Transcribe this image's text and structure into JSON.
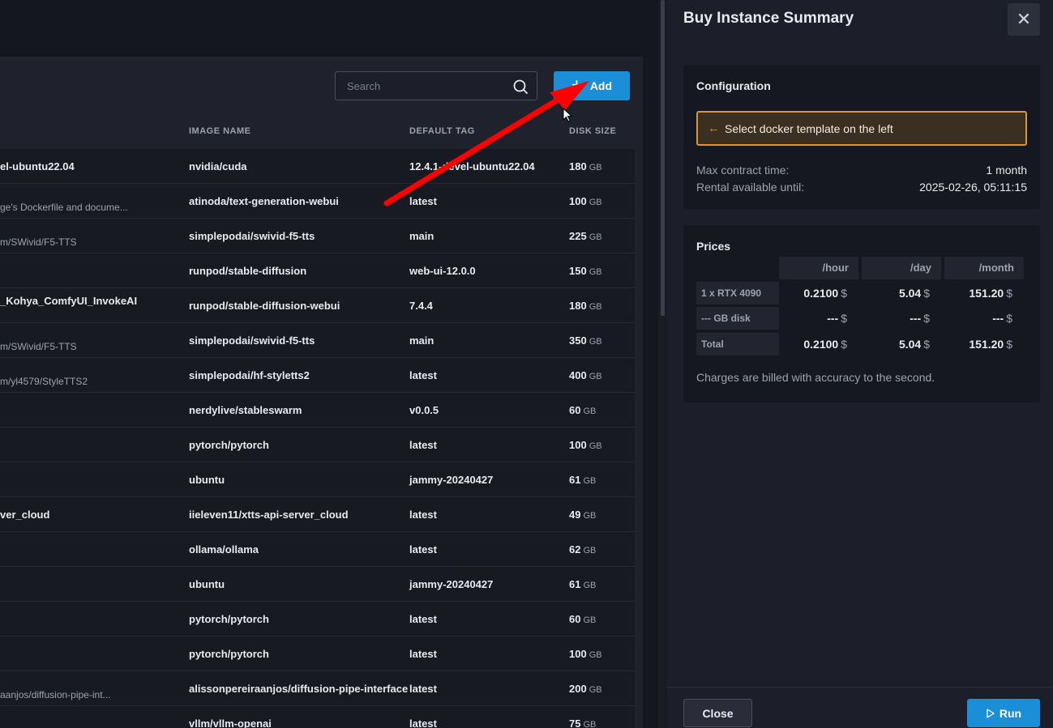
{
  "toolbar": {
    "search_placeholder": "Search",
    "add_label": "Add"
  },
  "table": {
    "headers": [
      "IMAGE NAME",
      "DEFAULT TAG",
      "DISK SIZE"
    ],
    "unit": "GB",
    "rows": [
      {
        "name": "el-ubuntu22.04",
        "image": "nvidia/cuda",
        "tag": "12.4.1-devel-ubuntu22.04",
        "size": "180"
      },
      {
        "name": "ge's Dockerfile and docume...",
        "image": "atinoda/text-generation-webui",
        "tag": "latest",
        "size": "100"
      },
      {
        "name": "m/SWivid/F5-TTS",
        "image": "simplepodai/swivid-f5-tts",
        "tag": "main",
        "size": "225"
      },
      {
        "name": "",
        "image": "runpod/stable-diffusion",
        "tag": "web-ui-12.0.0",
        "size": "150"
      },
      {
        "name": "_Kohya_ComfyUI_InvokeAI",
        "image": "runpod/stable-diffusion-webui",
        "tag": "7.4.4",
        "size": "180"
      },
      {
        "name": "m/SWivid/F5-TTS",
        "image": "simplepodai/swivid-f5-tts",
        "tag": "main",
        "size": "350"
      },
      {
        "name": "m/yl4579/StyleTTS2",
        "image": "simplepodai/hf-styletts2",
        "tag": "latest",
        "size": "400"
      },
      {
        "name": "",
        "image": "nerdylive/stableswarm",
        "tag": "v0.0.5",
        "size": "60"
      },
      {
        "name": "",
        "image": "pytorch/pytorch",
        "tag": "latest",
        "size": "100"
      },
      {
        "name": "",
        "image": "ubuntu",
        "tag": "jammy-20240427",
        "size": "61"
      },
      {
        "name": "ver_cloud",
        "image": "iieleven11/xtts-api-server_cloud",
        "tag": "latest",
        "size": "49"
      },
      {
        "name": "",
        "image": "ollama/ollama",
        "tag": "latest",
        "size": "62"
      },
      {
        "name": "",
        "image": "ubuntu",
        "tag": "jammy-20240427",
        "size": "61"
      },
      {
        "name": "",
        "image": "pytorch/pytorch",
        "tag": "latest",
        "size": "60"
      },
      {
        "name": "",
        "image": "pytorch/pytorch",
        "tag": "latest",
        "size": "100"
      },
      {
        "name": "aanjos/diffusion-pipe-int...",
        "image": "alissonpereiraanjos/diffusion-pipe-interface",
        "tag": "latest",
        "size": "200"
      },
      {
        "name": "",
        "image": "vllm/vllm-openai",
        "tag": "latest",
        "size": "75"
      }
    ]
  },
  "summary": {
    "title": "Buy Instance Summary",
    "configuration": {
      "title": "Configuration",
      "warning": "Select docker template on the left",
      "max_contract_label": "Max contract time:",
      "max_contract_value": "1 month",
      "rental_until_label": "Rental available until:",
      "rental_until_value": "2025-02-26, 05:11:15"
    },
    "prices": {
      "title": "Prices",
      "columns": [
        "/hour",
        "/day",
        "/month"
      ],
      "currency": "$",
      "rows": [
        {
          "label": "1 x RTX 4090",
          "values": [
            "0.2100",
            "5.04",
            "151.20"
          ]
        },
        {
          "label": "--- GB disk",
          "values": [
            "---",
            "---",
            "---"
          ]
        },
        {
          "label": "Total",
          "values": [
            "0.2100",
            "5.04",
            "151.20"
          ]
        }
      ],
      "note": "Charges are billed with accuracy to the second."
    },
    "close_label": "Close",
    "run_label": "Run"
  },
  "colors": {
    "accent": "#1a8fd8",
    "warning": "#d9953c",
    "annotation_arrow": "#ff0000"
  }
}
